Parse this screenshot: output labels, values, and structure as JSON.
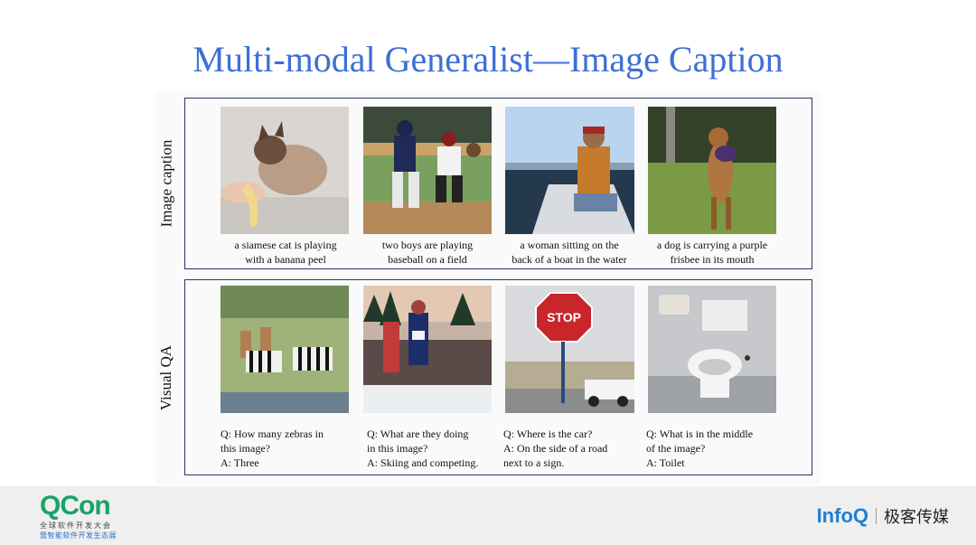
{
  "title": "Multi-modal Generalist—Image Caption",
  "sections": {
    "caption_label": "Image caption",
    "qa_label": "Visual QA"
  },
  "captions": [
    {
      "line1": "a siamese cat is playing",
      "line2": "with a banana peel"
    },
    {
      "line1": "two boys are playing",
      "line2": "baseball  on a field"
    },
    {
      "line1": "a woman sitting on the",
      "line2": "back of a boat in the water"
    },
    {
      "line1": "a dog is carrying a purple",
      "line2": "frisbee in its mouth"
    }
  ],
  "qa": [
    {
      "line1": "Q: How many zebras in",
      "line2": "this image?",
      "line3": "A: Three"
    },
    {
      "line1": "Q: What are they doing",
      "line2": "in this image?",
      "line3": "A: Skiing and competing."
    },
    {
      "line1": "Q: Where is the car?",
      "line2": "A: On the side of a road",
      "line3": "next to a sign."
    },
    {
      "line1": "Q: What is in the middle",
      "line2": "of the image?",
      "line3": "A: Toilet"
    }
  ],
  "image_text": {
    "stop_sign": "STOP"
  },
  "footer": {
    "qcon": "QCon",
    "qcon_sub1": "全球软件开发大会",
    "qcon_sub2": "暨智能软件开发生态展",
    "infoq": "InfoQ",
    "infoq_cn": "极客传媒"
  },
  "colors": {
    "title": "#3d6fd6",
    "panel_border": "#2a3566",
    "qcon_green": "#1aa36a",
    "infoq_blue": "#1e7fd6"
  }
}
